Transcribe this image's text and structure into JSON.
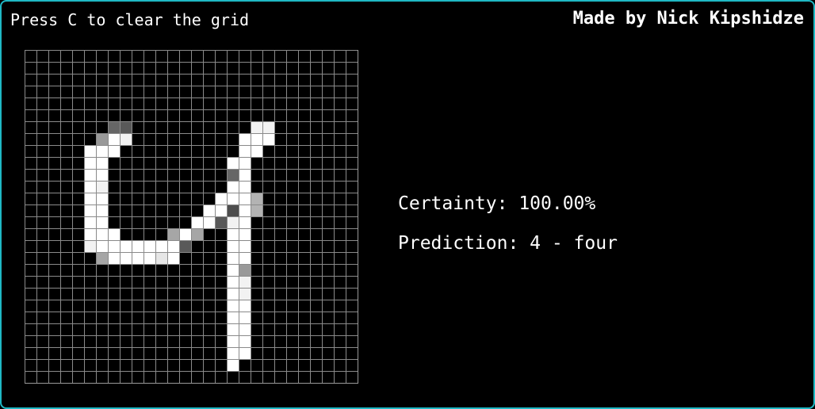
{
  "window": {
    "border_color": "#1fb8c4",
    "background": "#000000"
  },
  "header": {
    "hint": "Press C to clear the grid",
    "credit": "Made by Nick Kipshidze"
  },
  "results": {
    "certainty": "Certainty: 100.00%",
    "prediction": "Prediction: 4 - four"
  },
  "drawing_grid": {
    "rows": 28,
    "cols": 28,
    "grid_line_color": "#8a8a8a",
    "ink_color": "#ffffff",
    "painted_cells": [
      [
        6,
        7,
        0.4
      ],
      [
        6,
        8,
        0.35
      ],
      [
        6,
        19,
        0.95
      ],
      [
        6,
        20,
        0.95
      ],
      [
        7,
        6,
        0.6
      ],
      [
        7,
        7,
        1
      ],
      [
        7,
        8,
        0.95
      ],
      [
        7,
        18,
        1
      ],
      [
        7,
        19,
        1
      ],
      [
        7,
        20,
        1
      ],
      [
        8,
        5,
        1
      ],
      [
        8,
        6,
        1
      ],
      [
        8,
        7,
        1
      ],
      [
        8,
        18,
        1
      ],
      [
        8,
        19,
        1
      ],
      [
        9,
        5,
        1
      ],
      [
        9,
        6,
        1
      ],
      [
        9,
        17,
        1
      ],
      [
        9,
        18,
        1
      ],
      [
        10,
        5,
        1
      ],
      [
        10,
        6,
        1
      ],
      [
        10,
        17,
        0.4
      ],
      [
        10,
        18,
        1
      ],
      [
        11,
        5,
        1
      ],
      [
        11,
        6,
        0.95
      ],
      [
        11,
        17,
        1
      ],
      [
        11,
        18,
        1
      ],
      [
        12,
        5,
        1
      ],
      [
        12,
        6,
        1
      ],
      [
        12,
        16,
        1
      ],
      [
        12,
        17,
        1
      ],
      [
        12,
        18,
        1
      ],
      [
        12,
        19,
        0.7
      ],
      [
        13,
        5,
        1
      ],
      [
        13,
        6,
        1
      ],
      [
        13,
        15,
        1
      ],
      [
        13,
        16,
        1
      ],
      [
        13,
        17,
        0.3
      ],
      [
        13,
        18,
        1
      ],
      [
        13,
        19,
        0.7
      ],
      [
        14,
        5,
        1
      ],
      [
        14,
        6,
        1
      ],
      [
        14,
        14,
        1
      ],
      [
        14,
        15,
        1
      ],
      [
        14,
        16,
        0.35
      ],
      [
        14,
        17,
        0.95
      ],
      [
        14,
        18,
        1
      ],
      [
        15,
        5,
        1
      ],
      [
        15,
        6,
        1
      ],
      [
        15,
        7,
        1
      ],
      [
        15,
        12,
        0.65
      ],
      [
        15,
        13,
        1
      ],
      [
        15,
        14,
        0.65
      ],
      [
        15,
        17,
        1
      ],
      [
        15,
        18,
        1
      ],
      [
        16,
        5,
        0.95
      ],
      [
        16,
        6,
        1
      ],
      [
        16,
        7,
        1
      ],
      [
        16,
        8,
        1
      ],
      [
        16,
        9,
        1
      ],
      [
        16,
        10,
        1
      ],
      [
        16,
        11,
        1
      ],
      [
        16,
        12,
        1
      ],
      [
        16,
        13,
        0.35
      ],
      [
        16,
        17,
        1
      ],
      [
        16,
        18,
        1
      ],
      [
        17,
        6,
        0.65
      ],
      [
        17,
        7,
        1
      ],
      [
        17,
        8,
        1
      ],
      [
        17,
        9,
        1
      ],
      [
        17,
        10,
        1
      ],
      [
        17,
        11,
        0.9
      ],
      [
        17,
        12,
        1
      ],
      [
        17,
        17,
        1
      ],
      [
        17,
        18,
        1
      ],
      [
        18,
        17,
        1
      ],
      [
        18,
        18,
        0.6
      ],
      [
        19,
        17,
        1
      ],
      [
        19,
        18,
        0.95
      ],
      [
        20,
        17,
        1
      ],
      [
        20,
        18,
        0.95
      ],
      [
        21,
        17,
        1
      ],
      [
        21,
        18,
        1
      ],
      [
        22,
        17,
        1
      ],
      [
        22,
        18,
        1
      ],
      [
        23,
        17,
        1
      ],
      [
        23,
        18,
        1
      ],
      [
        24,
        17,
        1
      ],
      [
        24,
        18,
        1
      ],
      [
        25,
        17,
        1
      ],
      [
        25,
        18,
        1
      ],
      [
        26,
        17,
        1
      ]
    ]
  }
}
